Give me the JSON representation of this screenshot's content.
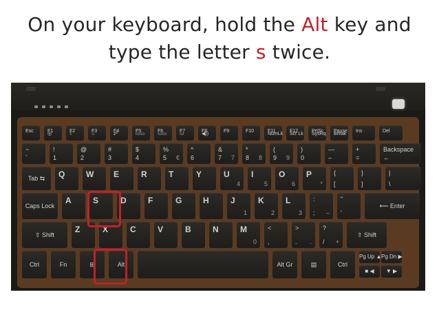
{
  "title": {
    "line1_pre": "On your keyboard, hold the ",
    "line1_key": "Alt",
    "line1_post": " key and",
    "line2_pre": "type the letter ",
    "line2_key": "s",
    "line2_post": " twice."
  },
  "colors": {
    "highlight": "#c0222a",
    "title_text": "#262626",
    "keyboard_surround": "#5a3b22"
  },
  "highlighted_keys": [
    "S",
    "Alt"
  ],
  "keyboard": {
    "row1": [
      {
        "id": "esc",
        "tl": "Esc"
      },
      {
        "id": "f1",
        "tl": "F1",
        "bl": "◎"
      },
      {
        "id": "f2",
        "tl": "F2",
        "bl": "☾"
      },
      {
        "id": "f3",
        "tl": "F3",
        "bl": "⌂"
      },
      {
        "id": "f4",
        "tl": "F4",
        "bl": "z²"
      },
      {
        "id": "f5",
        "tl": "F5",
        "bl": "▭▭"
      },
      {
        "id": "f6",
        "tl": "F6",
        "bl": "▭▭"
      },
      {
        "id": "f7",
        "tl": "F7",
        "bl": "▭"
      },
      {
        "id": "f8",
        "tl": "F8",
        "bl": "◀))"
      },
      {
        "id": "f9",
        "tl": "F9"
      },
      {
        "id": "f10",
        "tl": "F10"
      },
      {
        "id": "f11",
        "tl": "F11",
        "bl": "NumLk"
      },
      {
        "id": "f12",
        "tl": "F12",
        "bl": "Scr Lk"
      },
      {
        "id": "prtsc",
        "tl": "PrtSc",
        "bl": "SysRq"
      },
      {
        "id": "pause",
        "tl": "Pause",
        "bl": "Break"
      },
      {
        "id": "ins",
        "tl": "Ins"
      },
      {
        "id": "del",
        "tl": "Del"
      }
    ],
    "row2": [
      {
        "id": "tilde",
        "tl": "~",
        "bl": "`"
      },
      {
        "id": "k1",
        "tl": "!",
        "bl": "1"
      },
      {
        "id": "k2",
        "tl": "@",
        "bl": "2"
      },
      {
        "id": "k3",
        "tl": "#",
        "bl": "3"
      },
      {
        "id": "k4",
        "tl": "$",
        "bl": "4"
      },
      {
        "id": "k5",
        "tl": "%",
        "bl": "5",
        "br": "€"
      },
      {
        "id": "k6",
        "tl": "^",
        "bl": "6"
      },
      {
        "id": "k7",
        "tl": "&",
        "bl": "7",
        "br": "7"
      },
      {
        "id": "k8",
        "tl": "*",
        "bl": "8",
        "br": "8"
      },
      {
        "id": "k9",
        "tl": "(",
        "bl": "9",
        "br": "9"
      },
      {
        "id": "k0",
        "tl": ")",
        "bl": "0"
      },
      {
        "id": "minus",
        "tl": "—",
        "bl": "–"
      },
      {
        "id": "equals",
        "tl": "+",
        "bl": "="
      },
      {
        "id": "backspace",
        "tl": "Backspace",
        "bl": "←"
      }
    ],
    "row3": [
      {
        "id": "tab",
        "c": "Tab ⇆"
      },
      {
        "id": "q",
        "tl": "Q"
      },
      {
        "id": "w",
        "tl": "W"
      },
      {
        "id": "e",
        "tl": "E"
      },
      {
        "id": "r",
        "tl": "R"
      },
      {
        "id": "t",
        "tl": "T"
      },
      {
        "id": "y",
        "tl": "Y"
      },
      {
        "id": "u",
        "tl": "U",
        "br": "4"
      },
      {
        "id": "i",
        "tl": "I",
        "br": "5"
      },
      {
        "id": "o",
        "tl": "O",
        "br": "6"
      },
      {
        "id": "p",
        "tl": "P",
        "br": "*"
      },
      {
        "id": "lbracket",
        "tl": "{",
        "bl": "["
      },
      {
        "id": "rbracket",
        "tl": "}",
        "bl": "]"
      },
      {
        "id": "backslash",
        "tl": "|",
        "bl": "\\"
      }
    ],
    "row4": [
      {
        "id": "capslock",
        "c": "Caps Lock"
      },
      {
        "id": "a",
        "tl": "A"
      },
      {
        "id": "s",
        "tl": "S"
      },
      {
        "id": "d",
        "tl": "D"
      },
      {
        "id": "f",
        "tl": "F"
      },
      {
        "id": "g",
        "tl": "G"
      },
      {
        "id": "h",
        "tl": "H"
      },
      {
        "id": "j",
        "tl": "J",
        "br": "1"
      },
      {
        "id": "k",
        "tl": "K",
        "br": "2"
      },
      {
        "id": "l",
        "tl": "L",
        "br": "3"
      },
      {
        "id": "semicolon",
        "tl": ":",
        "bl": ";",
        "br": "–"
      },
      {
        "id": "quote",
        "tl": "\"",
        "bl": "'"
      },
      {
        "id": "enter",
        "c": "⟵ Enter"
      }
    ],
    "row5": [
      {
        "id": "lshift",
        "c": "⇧ Shift"
      },
      {
        "id": "z",
        "tl": "Z"
      },
      {
        "id": "x",
        "tl": "X"
      },
      {
        "id": "c",
        "tl": "C"
      },
      {
        "id": "v",
        "tl": "V"
      },
      {
        "id": "b",
        "tl": "B"
      },
      {
        "id": "n",
        "tl": "N"
      },
      {
        "id": "m",
        "tl": "M",
        "br": "0"
      },
      {
        "id": "comma",
        "tl": "<",
        "bl": ","
      },
      {
        "id": "period",
        "tl": ">",
        "bl": ".",
        "br": "."
      },
      {
        "id": "slash",
        "tl": "?",
        "bl": "/",
        "br": "+"
      },
      {
        "id": "rshift",
        "c": "⇧ Shift"
      }
    ],
    "row6": [
      {
        "id": "ctrl",
        "c": "Ctrl"
      },
      {
        "id": "fn",
        "c": "Fn"
      },
      {
        "id": "win",
        "c": "⊞"
      },
      {
        "id": "alt",
        "c": "Alt"
      },
      {
        "id": "space",
        "c": ""
      },
      {
        "id": "altgr",
        "c": "Alt Gr"
      },
      {
        "id": "menu",
        "c": "▤"
      },
      {
        "id": "rctrl",
        "c": "Ctrl"
      }
    ],
    "arrows": [
      {
        "id": "pgup",
        "c": "Pg Up ▲ ◀"
      },
      {
        "id": "pgdn",
        "c": "Pg Dn ▶"
      },
      {
        "id": "home",
        "c": "■ ◀"
      },
      {
        "id": "end",
        "c": "▼ ▶"
      }
    ]
  }
}
